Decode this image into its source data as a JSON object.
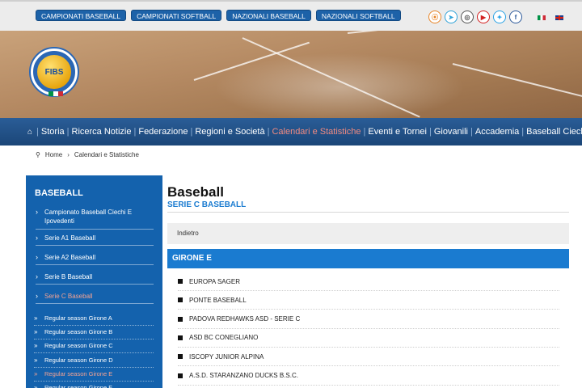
{
  "top_links": [
    "CAMPIONATI BASEBALL",
    "CAMPIONATI SOFTBALL",
    "NAZIONALI BASEBALL",
    "NAZIONALI SOFTBALL"
  ],
  "social": [
    {
      "icon": "rss-icon",
      "glyph": "⦿",
      "color": "#e8862a"
    },
    {
      "icon": "telegram-icon",
      "glyph": "➤",
      "color": "#2fa3d9"
    },
    {
      "icon": "instagram-icon",
      "glyph": "◎",
      "color": "#555555"
    },
    {
      "icon": "youtube-icon",
      "glyph": "▶",
      "color": "#d32020"
    },
    {
      "icon": "twitter-icon",
      "glyph": "✦",
      "color": "#2aa3e6"
    },
    {
      "icon": "facebook-icon",
      "glyph": "f",
      "color": "#2d5a9b"
    }
  ],
  "logo": {
    "text": "FIBS",
    "ring_text": "FEDERAZIONE ITALIANA BASEBALL SOFTBALL"
  },
  "nav": {
    "items": [
      "Storia",
      "Ricerca Notizie",
      "Federazione",
      "Regioni e Società",
      "Calendari e Statistiche",
      "Eventi e Tornei",
      "Giovanili",
      "Accademia",
      "Baseball Ciechi"
    ],
    "active_index": 4
  },
  "breadcrumb": {
    "home": "Home",
    "current": "Calendari e Statistiche"
  },
  "sidebar": {
    "title": "BASEBALL",
    "items": [
      "Campionato Baseball Ciechi E Ipovedenti",
      "Serie A1 Baseball",
      "Serie A2 Baseball",
      "Serie B Baseball",
      "Serie C Baseball"
    ],
    "active_item": 4,
    "subitems": [
      "Regular season Girone A",
      "Regular season Girone B",
      "Regular season Girone C",
      "Regular season Girone D",
      "Regular season Girone E",
      "Regular season Girone F"
    ],
    "active_sub": 4
  },
  "main": {
    "title": "Baseball",
    "subtitle": "SERIE C BASEBALL",
    "back_label": "Indietro",
    "girone": "GIRONE E",
    "teams": [
      "EUROPA SAGER",
      "PONTE BASEBALL",
      "PADOVA REDHAWKS ASD - SERIE C",
      "ASD BC CONEGLIANO",
      "ISCOPY JUNIOR ALPINA",
      "A.S.D. STARANZANO DUCKS B.S.C."
    ]
  },
  "colors": {
    "brand_blue": "#1462ad",
    "accent_blue": "#1a7bd0",
    "nav_blue": "#1e4e84",
    "active_link": "#f08a80"
  }
}
